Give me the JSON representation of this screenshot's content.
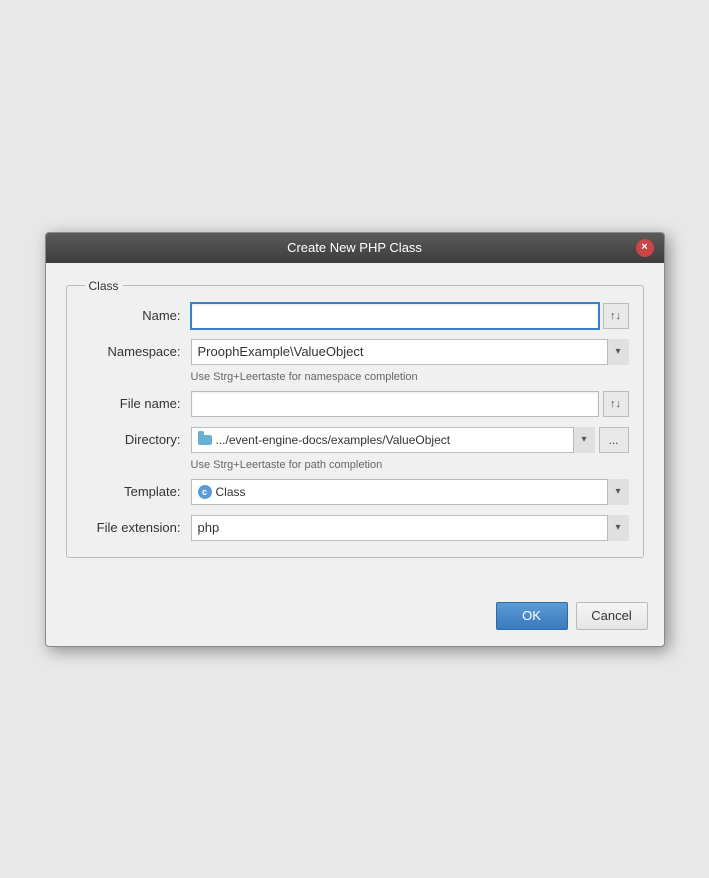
{
  "dialog": {
    "title": "Create New PHP Class",
    "close_label": "×"
  },
  "fieldset": {
    "legend": "Class"
  },
  "form": {
    "name_label": "Name:",
    "name_value": "",
    "name_placeholder": "",
    "namespace_label": "Namespace:",
    "namespace_value": "ProophExample\\ValueObject",
    "namespace_hint": "Use Strg+Leertaste for namespace completion",
    "filename_label": "File name:",
    "filename_value": "",
    "directory_label": "Directory:",
    "directory_value": ".../event-engine-docs/examples/ValueObject",
    "directory_hint": "Use Strg+Leertaste for path completion",
    "template_label": "Template:",
    "template_value": "Class",
    "file_extension_label": "File extension:",
    "file_extension_value": "php"
  },
  "buttons": {
    "ok_label": "OK",
    "cancel_label": "Cancel",
    "browse_label": "...",
    "sort_icon_label": "↑↓"
  },
  "icons": {
    "folder": "folder-icon",
    "template_circle": "c",
    "dropdown_arrow": "▾"
  }
}
